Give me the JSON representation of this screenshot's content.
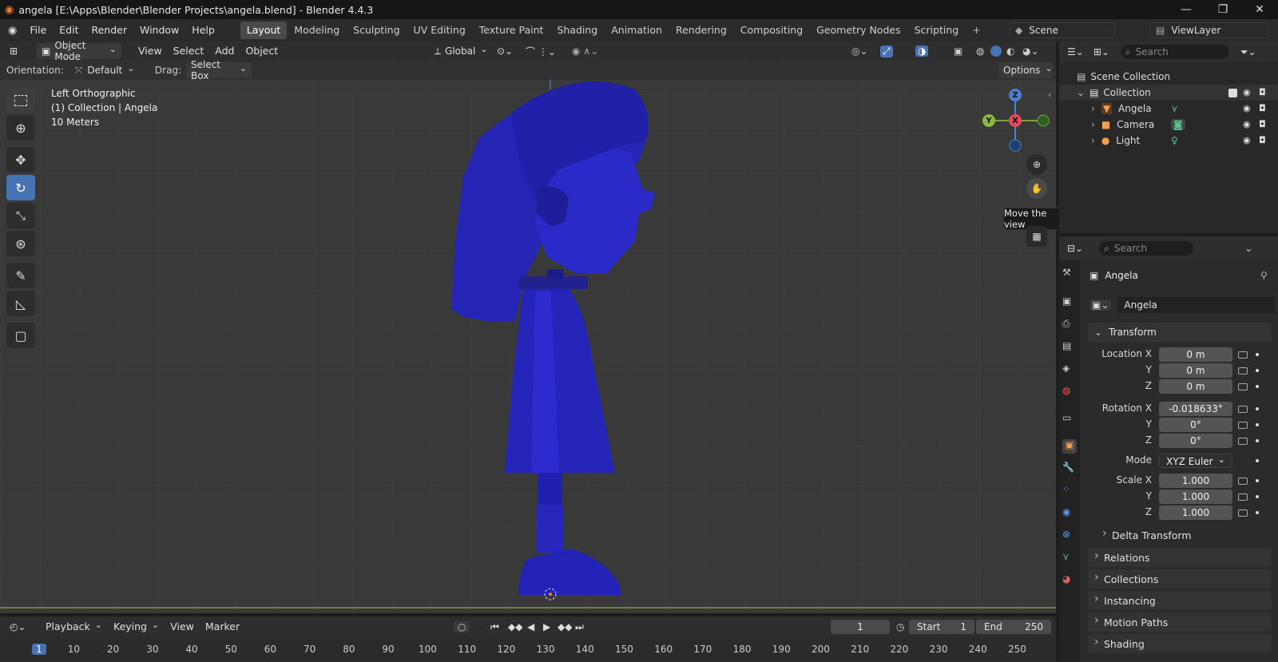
{
  "window": {
    "title": "angela [E:\\Apps\\Blender\\Blender Projects\\angela.blend] - Blender 4.4.3"
  },
  "menu": [
    "File",
    "Edit",
    "Render",
    "Window",
    "Help"
  ],
  "workspaces": [
    "Layout",
    "Modeling",
    "Sculpting",
    "UV Editing",
    "Texture Paint",
    "Shading",
    "Animation",
    "Rendering",
    "Compositing",
    "Geometry Nodes",
    "Scripting"
  ],
  "active_workspace": "Layout",
  "scene": {
    "name": "Scene",
    "view_layer": "ViewLayer"
  },
  "viewport": {
    "mode": "Object Mode",
    "menus": [
      "View",
      "Select",
      "Add",
      "Object"
    ],
    "transform_orientation": "Global",
    "orientation_label": "Orientation:",
    "orientation_value": "Default",
    "drag_label": "Drag:",
    "drag_value": "Select Box",
    "options": "Options",
    "info": {
      "view": "Left Orthographic",
      "collection": "(1) Collection | Angela",
      "scale": "10 Meters"
    },
    "tooltip": "Move the view",
    "gizmo": {
      "z": "Z",
      "y": "Y",
      "x": "X"
    },
    "model_color": "#2222c8"
  },
  "outliner": {
    "search_placeholder": "Search",
    "root": "Scene Collection",
    "collection": "Collection",
    "items": [
      "Angela",
      "Camera",
      "Light"
    ]
  },
  "properties": {
    "search_placeholder": "Search",
    "object_name": "Angela",
    "datablock": "Angela",
    "transform_title": "Transform",
    "location": {
      "label_x": "Location X",
      "label_y": "Y",
      "label_z": "Z",
      "x": "0 m",
      "y": "0 m",
      "z": "0 m"
    },
    "rotation": {
      "label_x": "Rotation X",
      "label_y": "Y",
      "label_z": "Z",
      "x": "-0.018633°",
      "y": "0°",
      "z": "0°"
    },
    "mode": {
      "label": "Mode",
      "value": "XYZ Euler"
    },
    "scale": {
      "label_x": "Scale X",
      "label_y": "Y",
      "label_z": "Z",
      "x": "1.000",
      "y": "1.000",
      "z": "1.000"
    },
    "delta": "Delta Transform",
    "panels": [
      "Relations",
      "Collections",
      "Instancing",
      "Motion Paths",
      "Shading"
    ]
  },
  "timeline": {
    "menus": [
      "Playback",
      "Keying",
      "View",
      "Marker"
    ],
    "current_frame": "1",
    "start_label": "Start",
    "start": "1",
    "end_label": "End",
    "end": "250",
    "ticks": [
      "1",
      "10",
      "20",
      "30",
      "40",
      "50",
      "60",
      "70",
      "80",
      "90",
      "100",
      "110",
      "120",
      "130",
      "140",
      "150",
      "160",
      "170",
      "180",
      "190",
      "200",
      "210",
      "220",
      "230",
      "240",
      "250"
    ]
  }
}
